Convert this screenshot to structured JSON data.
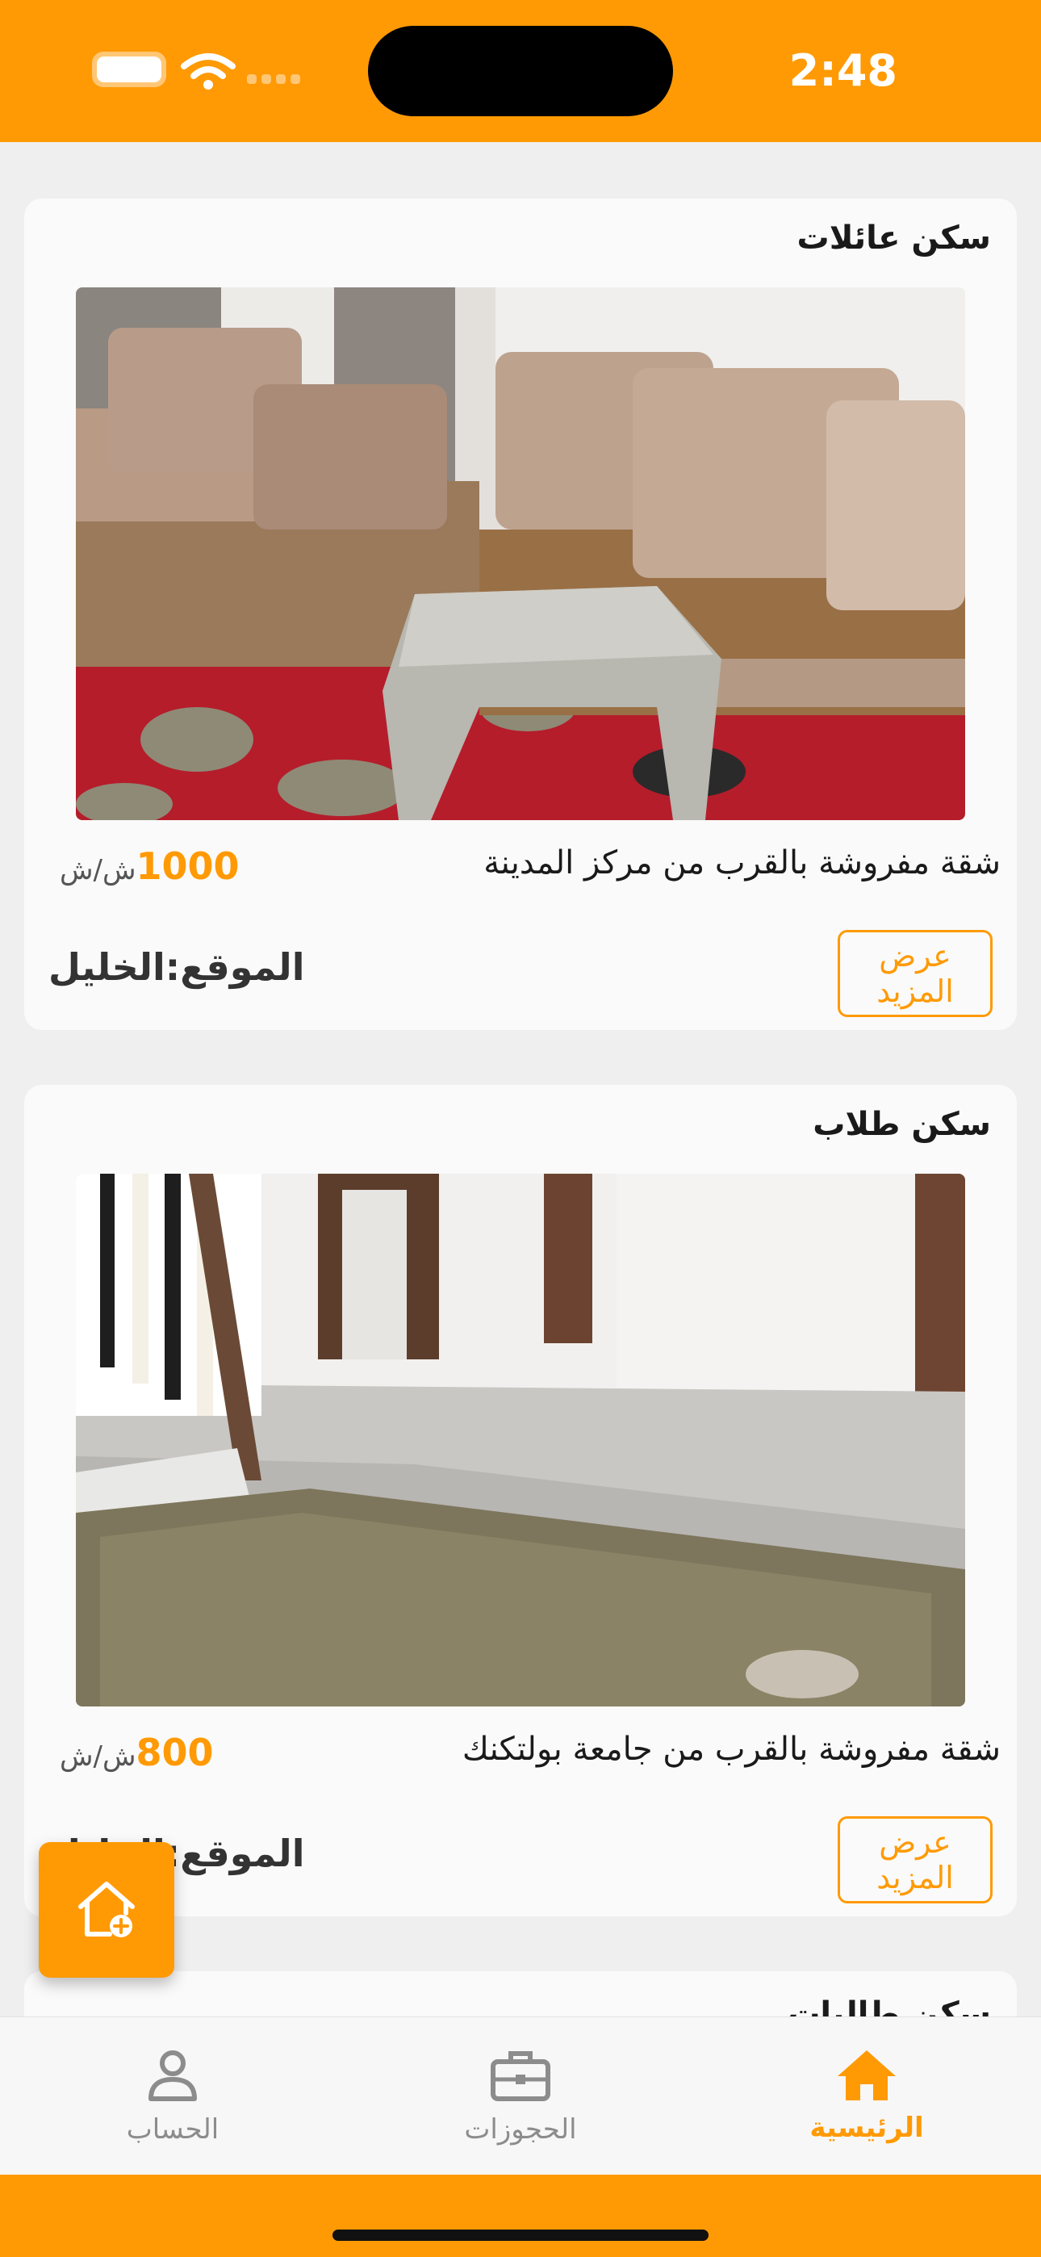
{
  "status_bar": {
    "time": "2:48",
    "background": "#ff9a05",
    "icons": [
      "battery-icon",
      "wifi-icon",
      "cellular-signal-icon"
    ]
  },
  "listings": [
    {
      "category": "سكن عائلات",
      "photo_icon": "living-room-photo",
      "description": "شقة مفروشة بالقرب من مركز المدينة",
      "price": "1000",
      "price_unit": "ش/ش",
      "location": "الموقع:الخليل",
      "more_label": "عرض المزيد"
    },
    {
      "category": "سكن طلاب",
      "photo_icon": "hallway-photo",
      "description": "شقة مفروشة بالقرب من جامعة بولتكنك",
      "price": "800",
      "price_unit": "ش/ش",
      "location": "الموقع:الخليل",
      "more_label": "عرض المزيد"
    },
    {
      "category": "سكن طالبات"
    }
  ],
  "fab": {
    "icon": "add-home-icon"
  },
  "bottom_nav": {
    "items": [
      {
        "label": "الحساب",
        "icon": "person-icon",
        "active": false
      },
      {
        "label": "الحجوزات",
        "icon": "briefcase-icon",
        "active": false
      },
      {
        "label": "الرئيسية",
        "icon": "home-icon",
        "active": true
      }
    ]
  },
  "colors": {
    "accent": "#ff9a05",
    "background": "#efefef",
    "card": "#fafafa"
  }
}
